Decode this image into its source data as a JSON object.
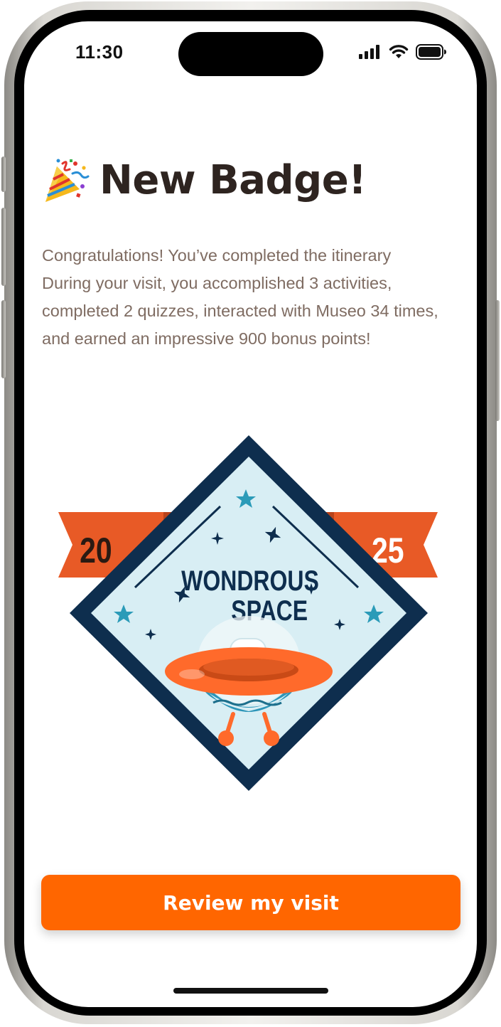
{
  "status_bar": {
    "time": "11:30",
    "icons": [
      "cellular-signal-icon",
      "wifi-icon",
      "battery-icon"
    ]
  },
  "header": {
    "emoji": "🎉",
    "emoji_icon": "party-popper-icon",
    "title": "New Badge!"
  },
  "message": "Congratulations! You’ve completed the itinerary During your visit, you accomplished 3 activities, completed 2 quizzes, interacted with Museo 34 times, and earned an impressive 900 bonus points!",
  "badge": {
    "year_left": "20",
    "year_right": "25",
    "line1": "WONDROUS",
    "line2": "SPACE",
    "colors": {
      "navy": "#0e2e4e",
      "ribbon": "#e85a26",
      "ribbon_dark": "#b8421a",
      "inner": "#d8eef4",
      "star": "#2b9bb8",
      "ufo_orange": "#ff6a2b",
      "ufo_teal": "#2d95b8"
    }
  },
  "actions": {
    "review_label": "Review my visit"
  },
  "theme": {
    "accent": "#ff6600",
    "title_color": "#2e2420",
    "body_color": "#7f6c62"
  }
}
